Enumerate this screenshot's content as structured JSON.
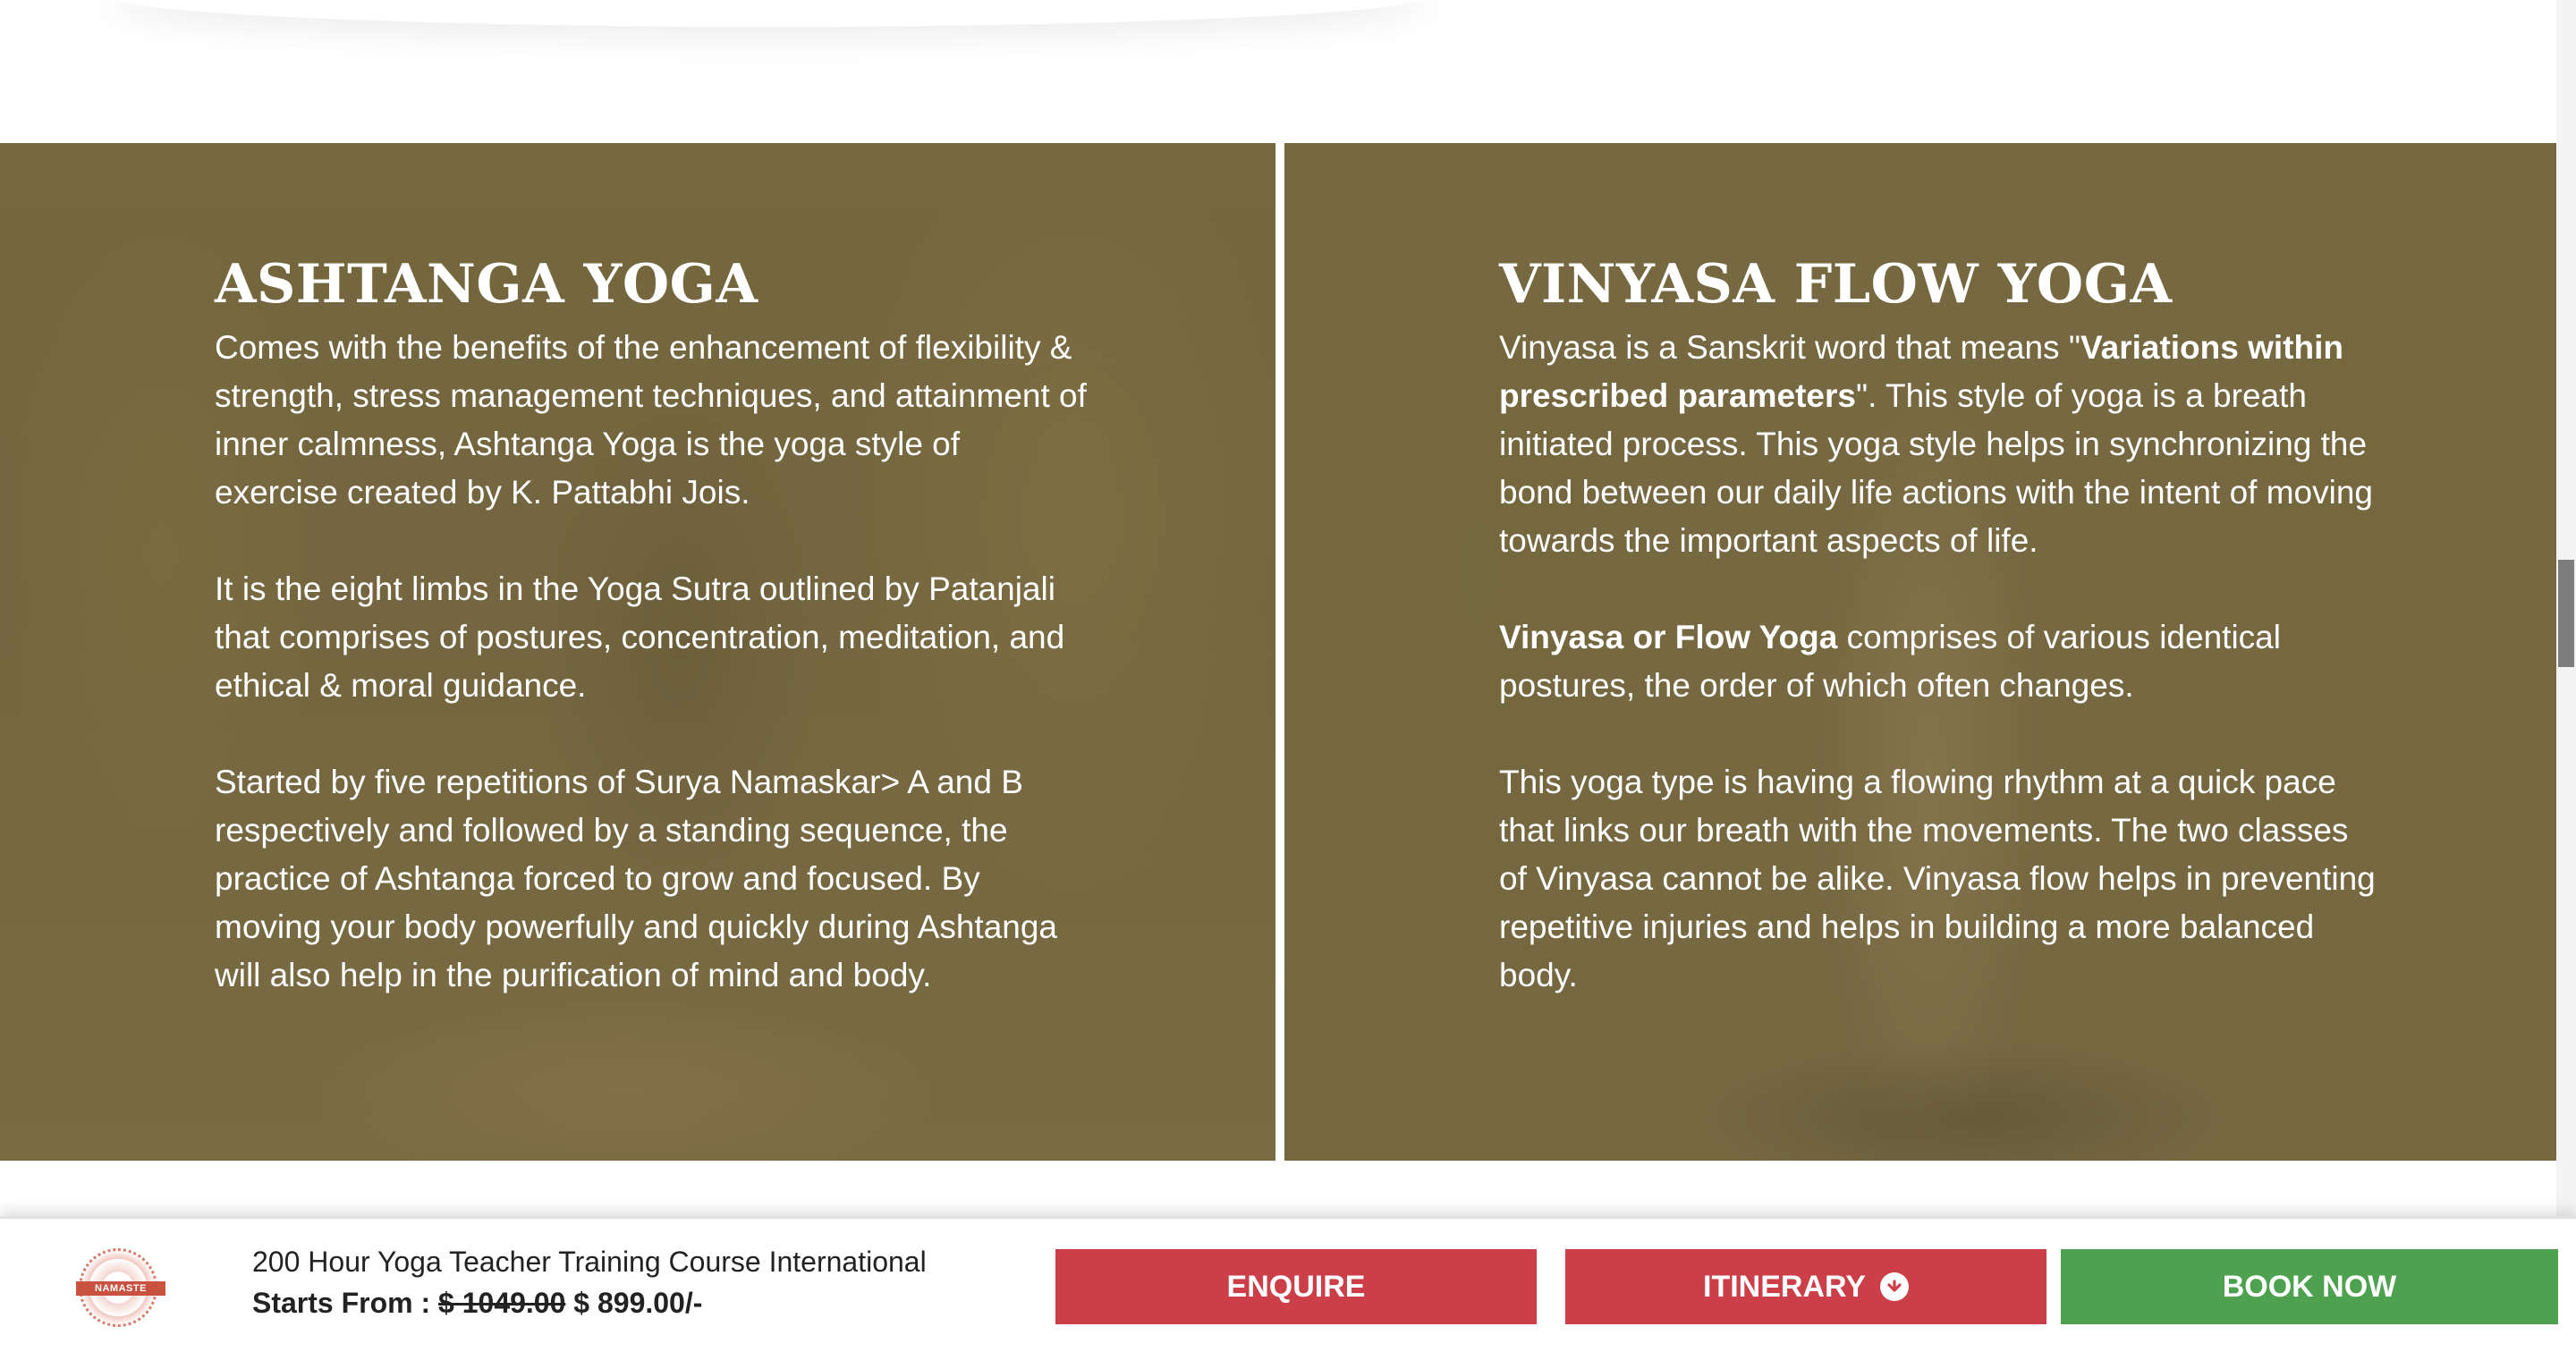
{
  "sections": [
    {
      "title": "ASHTANGA YOGA",
      "paragraphs": [
        "Comes with the benefits of the enhancement of flexibility & strength, stress management techniques, and attainment of inner calmness, Ashtanga Yoga is the yoga style of exercise created by K. Pattabhi Jois.",
        "It is the eight limbs in the Yoga Sutra outlined by Patanjali that comprises of postures, concentration, meditation, and ethical & moral guidance.",
        "Started by five repetitions of Surya Namaskar> A and B respectively and followed by a standing sequence, the practice of Ashtanga forced to grow and focused. By moving your body powerfully and quickly during Ashtanga will also help in the purification of mind and body."
      ]
    },
    {
      "title": "VINYASA FLOW YOGA",
      "p1_a": "Vinyasa is a Sanskrit word that means \"",
      "p1_bold": "Variations within prescribed parameters",
      "p1_b": "\". This style of yoga is a breath initiated process. This yoga style helps in synchronizing the bond between our daily life actions with the intent of moving towards the important aspects of life.",
      "p2_bold": "Vinyasa or Flow Yoga",
      "p2_rest": " comprises of various identical postures, the order of which often changes.",
      "p3": "This yoga type is having a flowing rhythm at a quick pace that links our breath with the movements. The two classes of Vinyasa cannot be alike. Vinyasa flow helps in preventing repetitive injuries and helps in building a more balanced body."
    }
  ],
  "bottom_bar": {
    "logo_text": "NAMASTE",
    "course_title": "200 Hour Yoga Teacher Training Course International",
    "starts_from_label": "Starts From : ",
    "old_price": "$ 1049.00",
    "new_price": " $ 899.00/-",
    "enquire_label": "ENQUIRE",
    "itinerary_label": "ITINERARY",
    "book_now_label": "BOOK NOW",
    "itinerary_icon": "chevron-down-circle-icon"
  },
  "colors": {
    "enquire": "#cc3f48",
    "itinerary": "#cc3f48",
    "book_now": "#4ea14f",
    "panel_tint": "#7a6c45"
  }
}
